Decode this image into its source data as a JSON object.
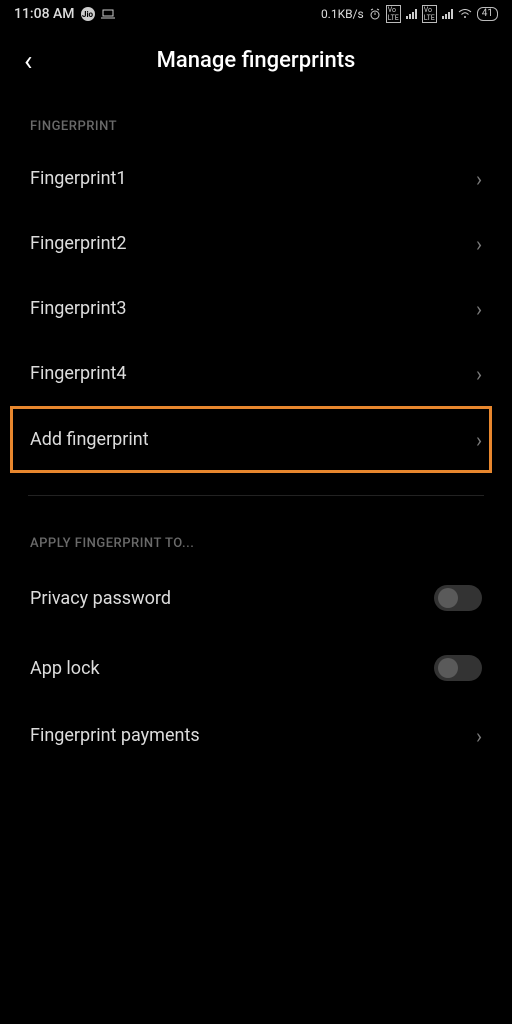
{
  "status": {
    "time": "11:08 AM",
    "carrier": "Jio",
    "data_rate": "0.1KB/s",
    "volte1": "Vo LTE",
    "volte2": "Vo LTE",
    "battery": "41"
  },
  "header": {
    "title": "Manage fingerprints"
  },
  "sections": {
    "fingerprint_header": "FINGERPRINT",
    "apply_header": "APPLY FINGERPRINT TO..."
  },
  "fingerprints": [
    "Fingerprint1",
    "Fingerprint2",
    "Fingerprint3",
    "Fingerprint4"
  ],
  "add_fingerprint": "Add fingerprint",
  "apply_items": {
    "privacy_password": "Privacy password",
    "app_lock": "App lock",
    "fingerprint_payments": "Fingerprint payments"
  }
}
